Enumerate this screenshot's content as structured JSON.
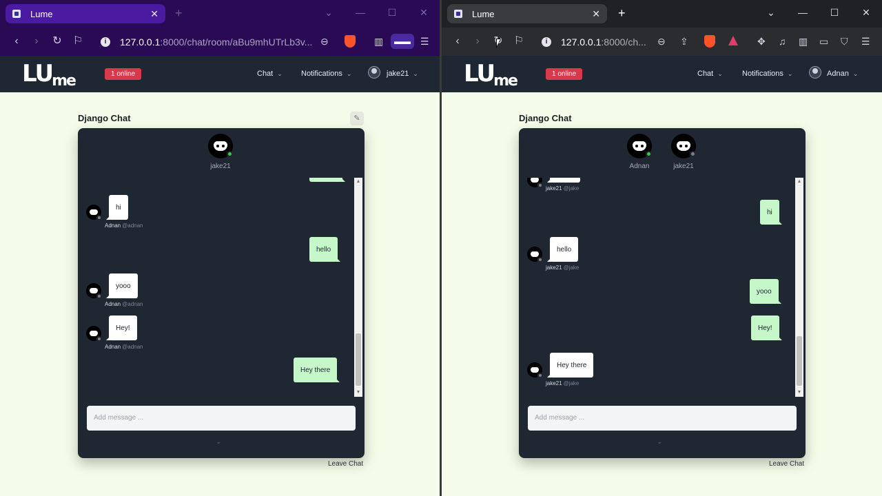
{
  "left": {
    "tab_title": "Lume",
    "tab_close": "✕",
    "newtab": "+",
    "winctl": [
      "⌄",
      "—",
      "☐",
      "✕"
    ],
    "url_host": "127.0.0.1",
    "url_path": ":8000/chat/room/aBu9mhUTrLb3v...",
    "online_badge": "1 online",
    "menu_chat": "Chat",
    "menu_notifications": "Notifications",
    "menu_user": "jake21",
    "room_title": "Django Chat",
    "members": [
      {
        "name": "jake21",
        "online": true
      }
    ],
    "input_placeholder": "Add message ...",
    "leave": "Leave Chat",
    "messages": [
      {
        "text": "hi",
        "dir": "in",
        "sender": "Adnan",
        "handle": "@adnan"
      },
      {
        "text": "hello",
        "dir": "out"
      },
      {
        "text": "yooo",
        "dir": "in",
        "sender": "Adnan",
        "handle": "@adnan"
      },
      {
        "text": "Hey!",
        "dir": "in",
        "sender": "Adnan",
        "handle": "@adnan"
      },
      {
        "text": "Hey there",
        "dir": "out"
      }
    ]
  },
  "right": {
    "tab_title": "Lume",
    "tab_close": "✕",
    "newtab": "+",
    "winctl": [
      "⌄",
      "—",
      "☐",
      "✕"
    ],
    "url_host": "127.0.0.1",
    "url_path": ":8000/ch...",
    "online_badge": "1 online",
    "menu_chat": "Chat",
    "menu_notifications": "Notifications",
    "menu_user": "Adnan",
    "room_title": "Django Chat",
    "members": [
      {
        "name": "Adnan",
        "online": true
      },
      {
        "name": "jake21",
        "online": false
      }
    ],
    "input_placeholder": "Add message ...",
    "leave": "Leave Chat",
    "messages": [
      {
        "text": "",
        "dir": "in",
        "sender": "jake21",
        "handle": "@jake"
      },
      {
        "text": "hi",
        "dir": "out"
      },
      {
        "text": "hello",
        "dir": "in",
        "sender": "jake21",
        "handle": "@jake"
      },
      {
        "text": "yooo",
        "dir": "out"
      },
      {
        "text": "Hey!",
        "dir": "out"
      },
      {
        "text": "Hey there",
        "dir": "in",
        "sender": "jake21",
        "handle": "@jake"
      }
    ]
  },
  "logo": "LU",
  "logo_small": "me",
  "colors": {
    "accent_left": "#2a0a55",
    "header": "#1f2733",
    "online": "#d93a4b",
    "bubble_out": "#c5f7c9",
    "bg": "#f4fbe8"
  }
}
